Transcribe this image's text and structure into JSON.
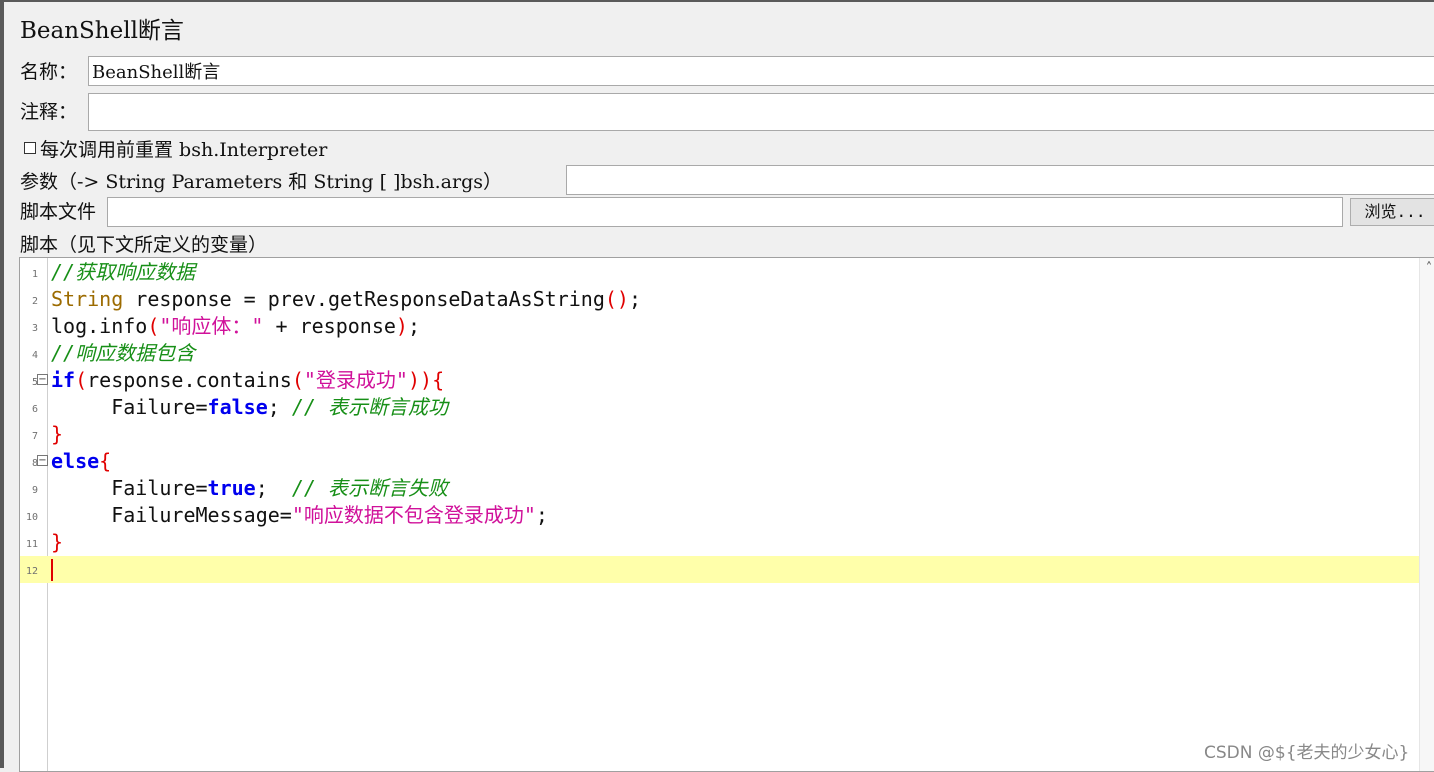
{
  "title": "BeanShell断言",
  "name_field": {
    "label": "名称：",
    "value": "BeanShell断言"
  },
  "comment_field": {
    "label": "注释：",
    "value": ""
  },
  "reset_interpreter": {
    "label": "每次调用前重置 bsh.Interpreter",
    "checked": false
  },
  "parameters": {
    "label": "参数（-> String Parameters 和 String [ ]bsh.args）",
    "value": ""
  },
  "script_file": {
    "label": "脚本文件",
    "value": "",
    "browse_label": "浏览..."
  },
  "script_label": "脚本（见下文所定义的变量）",
  "editor": {
    "lines": [
      {
        "num": "1",
        "fold": "",
        "tokens": [
          {
            "t": "//获取响应数据",
            "c": "cm"
          }
        ]
      },
      {
        "num": "2",
        "fold": "",
        "tokens": [
          {
            "t": "String",
            "c": "type"
          },
          {
            "t": " response = prev.getResponseDataAsString",
            "c": ""
          },
          {
            "t": "()",
            "c": "br"
          },
          {
            "t": ";",
            "c": ""
          }
        ]
      },
      {
        "num": "3",
        "fold": "",
        "tokens": [
          {
            "t": "log.info",
            "c": ""
          },
          {
            "t": "(",
            "c": "br"
          },
          {
            "t": "\"响应体：\"",
            "c": "str"
          },
          {
            "t": " + response",
            "c": ""
          },
          {
            "t": ")",
            "c": "br"
          },
          {
            "t": ";",
            "c": ""
          }
        ]
      },
      {
        "num": "4",
        "fold": "",
        "tokens": [
          {
            "t": "//响应数据包含",
            "c": "cm"
          }
        ]
      },
      {
        "num": "5",
        "fold": "⊟",
        "tokens": [
          {
            "t": "if",
            "c": "kw"
          },
          {
            "t": "(",
            "c": "br"
          },
          {
            "t": "response.contains",
            "c": ""
          },
          {
            "t": "(",
            "c": "br"
          },
          {
            "t": "\"登录成功\"",
            "c": "str"
          },
          {
            "t": ")){",
            "c": "br"
          }
        ]
      },
      {
        "num": "6",
        "fold": "",
        "tokens": [
          {
            "t": "     Failure=",
            "c": ""
          },
          {
            "t": "false",
            "c": "kw"
          },
          {
            "t": "; ",
            "c": ""
          },
          {
            "t": "// 表示断言成功",
            "c": "cm"
          }
        ]
      },
      {
        "num": "7",
        "fold": "",
        "tokens": [
          {
            "t": "}",
            "c": "br"
          }
        ]
      },
      {
        "num": "8",
        "fold": "⊟",
        "tokens": [
          {
            "t": "else",
            "c": "kw"
          },
          {
            "t": "{",
            "c": "br"
          }
        ]
      },
      {
        "num": "9",
        "fold": "",
        "tokens": [
          {
            "t": "     Failure=",
            "c": ""
          },
          {
            "t": "true",
            "c": "kw"
          },
          {
            "t": ";  ",
            "c": ""
          },
          {
            "t": "// 表示断言失败",
            "c": "cm"
          }
        ]
      },
      {
        "num": "10",
        "fold": "",
        "tokens": [
          {
            "t": "     FailureMessage=",
            "c": ""
          },
          {
            "t": "\"响应数据不包含登录成功\"",
            "c": "str"
          },
          {
            "t": ";",
            "c": ""
          }
        ]
      },
      {
        "num": "11",
        "fold": "",
        "tokens": [
          {
            "t": "}",
            "c": "br"
          }
        ]
      },
      {
        "num": "12",
        "fold": "",
        "tokens": [],
        "current": true
      }
    ]
  },
  "watermark": "CSDN @${老夫的少女心}"
}
